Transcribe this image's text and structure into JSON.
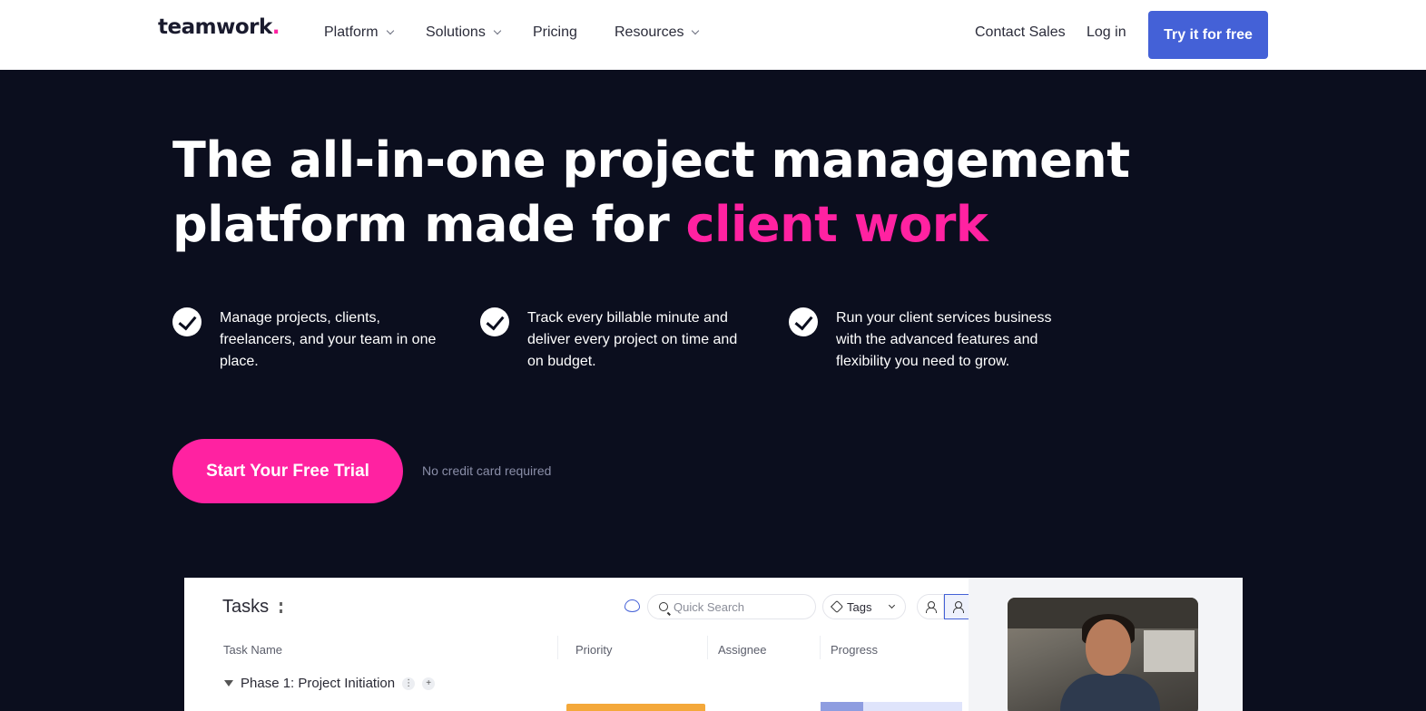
{
  "nav": {
    "logo_text": "teamwork",
    "logo_dot": ".",
    "items": [
      {
        "label": "Platform",
        "dropdown": true
      },
      {
        "label": "Solutions",
        "dropdown": true
      },
      {
        "label": "Pricing",
        "dropdown": false
      },
      {
        "label": "Resources",
        "dropdown": true
      }
    ],
    "contact_sales": "Contact Sales",
    "login": "Log in",
    "try_button": "Try it for free"
  },
  "hero": {
    "title_line1": "The all-in-one project management",
    "title_line2_prefix": "platform made for ",
    "title_accent": "client work",
    "features": [
      "Manage projects, clients, freelancers, and your team in one place.",
      "Track every billable minute and deliver every project on time and on budget.",
      "Run your client services business with the advanced features and flexibility you need to grow."
    ],
    "cta_label": "Start Your Free Trial",
    "cta_note": "No credit card required"
  },
  "preview": {
    "title": "Tasks",
    "search_placeholder": "Quick Search",
    "tags_label": "Tags",
    "columns": [
      "Task Name",
      "Priority",
      "Assignee",
      "Progress"
    ],
    "phase_label": "Phase 1: Project Initiation",
    "add_symbol": "+",
    "progress_fraction": 0.3
  },
  "colors": {
    "accent_pink": "#ff22a1",
    "brand_blue": "#4461d7",
    "hero_bg": "#0b0e1e",
    "priority_orange": "#f4a83a"
  },
  "icons": [
    "chevron-down-icon",
    "check-icon",
    "chat-icon",
    "search-icon",
    "tag-icon",
    "user-icon",
    "users-icon",
    "kebab-menu-icon",
    "collapse-triangle-icon"
  ]
}
